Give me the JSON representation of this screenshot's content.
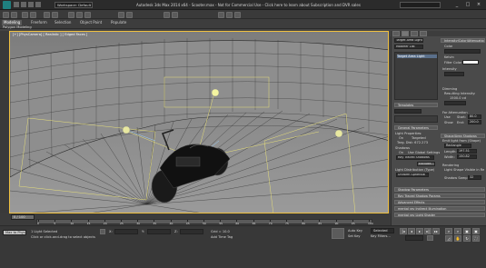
{
  "window": {
    "workspace": "Workspace: Default",
    "title": "Autodesk 3ds Max 2014 x64 - Scooter.max - Not for Commercial Use - Click here to learn about Subscription and DVR sales"
  },
  "ribbon": {
    "tabs": [
      "Modeling",
      "Freeform",
      "Selection",
      "Object Paint",
      "Populate"
    ],
    "active_tab": "Modeling",
    "sub_label": "Polygon Modeling"
  },
  "viewport": {
    "label": "[+] [PhysCamera] [ Realistic ] [ Edged Faces ]",
    "frame_color": "#f0c040"
  },
  "command_panel": {
    "name_field": "Target Area Light",
    "mod_list": "Modifier List",
    "stack_item": "Target Area Light",
    "rollups": {
      "templates": "Templates",
      "general": "General Parameters",
      "light_props": "Light Properties:",
      "on": "On",
      "targeted": "Targeted",
      "targ_dist": "Targ. Dist: 672.273",
      "shadows": "Shadows",
      "use_global": "Use Global Settings",
      "shadow_type": "Ray Traced Shadows",
      "exclude": "Exclude...",
      "light_dist": "Light Distribution (Type)",
      "uniform": "Uniform Spherical",
      "shadow_params": "Shadow Parameters",
      "ray_traced": "Ray Traced Shadow Params",
      "advanced": "Advanced Effects",
      "mental_ray_indirect": "mental ray Indirect Illumination",
      "mental_ray_shader": "mental ray Light Shader"
    },
    "intensity": {
      "header": "Intensity/Color/Attenuation",
      "color": "Color",
      "kelvin": "Kelvin",
      "filter": "Filter Color",
      "intensity": "Intensity",
      "dimming": "Dimming",
      "resulting": "Resulting Intensity:",
      "value": "1500.0 cd",
      "far_attenuation": "Far Attenuation",
      "use": "Use",
      "show": "Show",
      "start": "Start:",
      "end": "End:",
      "start_val": "80.0",
      "end_val": "200.0"
    },
    "shape": {
      "header": "Shape/Area Shadows",
      "emit": "Emit light from (Shape)",
      "shape_value": "Rectangle",
      "length": "Length:",
      "width": "Width:",
      "length_val": "197.51",
      "width_val": "150.82",
      "rendering": "Rendering",
      "light_shape": "Light Shape Visible in Rendering",
      "shadow_samples": "Shadow Samples:",
      "samples_val": "32"
    }
  },
  "timeline": {
    "frame": "0 / 100",
    "ticks": [
      "0",
      "5",
      "10",
      "15",
      "20",
      "25",
      "30",
      "35",
      "40",
      "45",
      "50",
      "55",
      "60",
      "65",
      "70",
      "75",
      "80",
      "85",
      "90",
      "95",
      "100"
    ]
  },
  "status": {
    "script": "Max to Phys",
    "selected": "1 Light Selected",
    "prompt": "Click or click-and-drag to select objects",
    "x": "X:",
    "y": "Y:",
    "z": "Z:",
    "grid": "Grid = 10.0",
    "auto_key": "Auto Key",
    "set_key": "Set Key",
    "selected_mode": "Selected",
    "key_filters": "Key Filters...",
    "add_time_tag": "Add Time Tag"
  }
}
